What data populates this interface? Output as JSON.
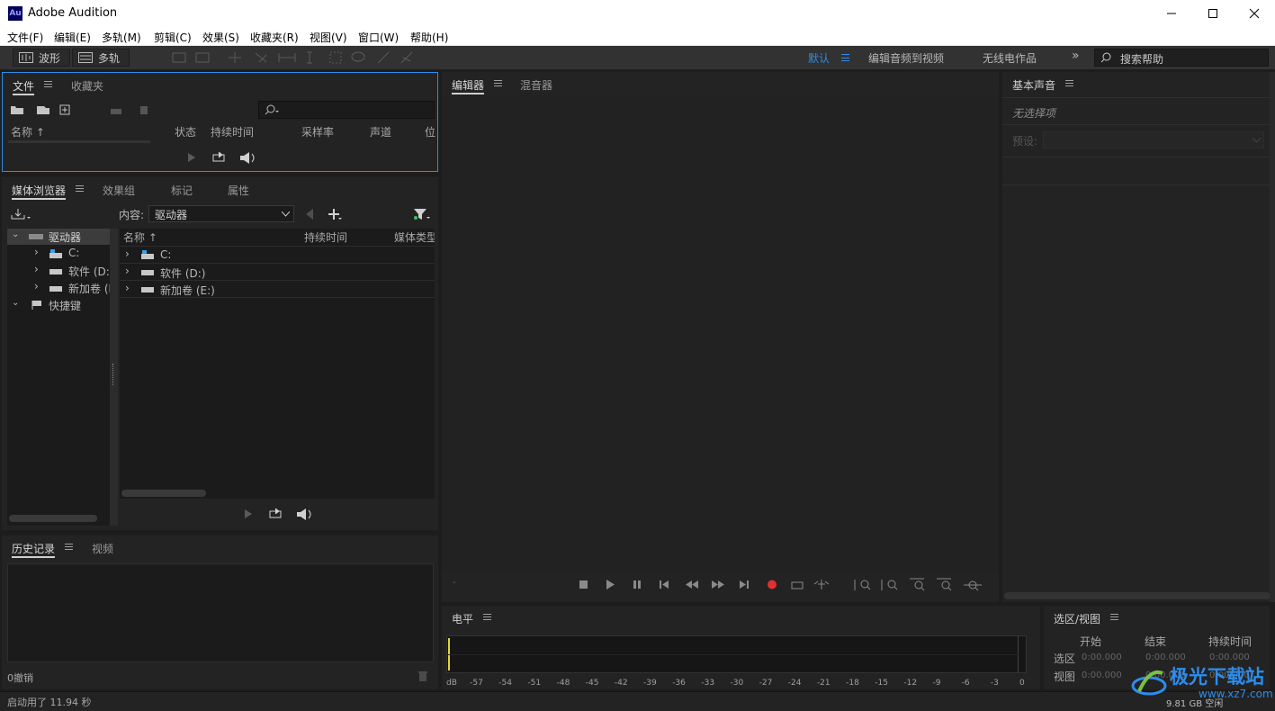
{
  "window": {
    "app_icon_text": "Au",
    "title": "Adobe Audition"
  },
  "menu": [
    "文件(F)",
    "编辑(E)",
    "多轨(M)",
    "剪辑(C)",
    "效果(S)",
    "收藏夹(R)",
    "视图(V)",
    "窗口(W)",
    "帮助(H)"
  ],
  "toolbar": {
    "waveform_label": "波形",
    "multitrack_label": "多轨",
    "workspaces": [
      "默认",
      "编辑音频到视频",
      "无线电作品"
    ],
    "active_workspace": "默认",
    "search_placeholder": "搜索帮助"
  },
  "files_panel": {
    "tabs": [
      "文件",
      "收藏夹"
    ],
    "columns": [
      "名称",
      "状态",
      "持续时间",
      "采样率",
      "声道",
      "位"
    ],
    "search_value": ""
  },
  "media_browser": {
    "tabs": [
      "媒体浏览器",
      "效果组",
      "标记",
      "属性"
    ],
    "content_label": "内容:",
    "content_value": "驱动器",
    "tree": [
      {
        "label": "驱动器",
        "expanded": true,
        "icon": "drive-group-icon"
      },
      {
        "label": "C:",
        "icon": "system-drive-icon"
      },
      {
        "label": "软件 (D:)",
        "icon": "drive-icon"
      },
      {
        "label": "新加卷 (I",
        "icon": "drive-icon"
      },
      {
        "label": "快捷键",
        "expanded": true,
        "icon": "shortcut-icon"
      }
    ],
    "columns": [
      "名称",
      "持续时间",
      "媒体类型"
    ],
    "list": [
      "C:",
      "软件 (D:)",
      "新加卷 (E:)"
    ]
  },
  "history_panel": {
    "tabs": [
      "历史记录",
      "视频"
    ],
    "undo_count": "0撤销"
  },
  "editor_panel": {
    "tabs": [
      "编辑器",
      "混音器"
    ],
    "record_color": "#e03030"
  },
  "essential_sound": {
    "title": "基本声音",
    "no_selection": "无选择项",
    "preset_label": "预设:"
  },
  "levels_panel": {
    "title": "电平",
    "scale": [
      "dB",
      "-57",
      "-54",
      "-51",
      "-48",
      "-45",
      "-42",
      "-39",
      "-36",
      "-33",
      "-30",
      "-27",
      "-24",
      "-21",
      "-18",
      "-15",
      "-12",
      "-9",
      "-6",
      "-3",
      "0"
    ]
  },
  "selection_view": {
    "title": "选区/视图",
    "headers": [
      "开始",
      "结束",
      "持续时间"
    ],
    "rows": [
      {
        "label": "选区",
        "start": "0:00.000",
        "end": "0:00.000",
        "duration": "0:00.000"
      },
      {
        "label": "视图",
        "start": "0:00.000",
        "end": "0:00.000",
        "duration": "0:00.000"
      }
    ]
  },
  "status_bar": {
    "startup": "启动用了 11.94 秒",
    "free_space": "9.81 GB 空闲"
  },
  "watermark": {
    "text": "极光下载站",
    "url": "www.xz7.com"
  },
  "colors": {
    "accent_blue": "#2d8ceb",
    "panel_bg": "#232323",
    "app_bg": "#1d1d1d"
  }
}
